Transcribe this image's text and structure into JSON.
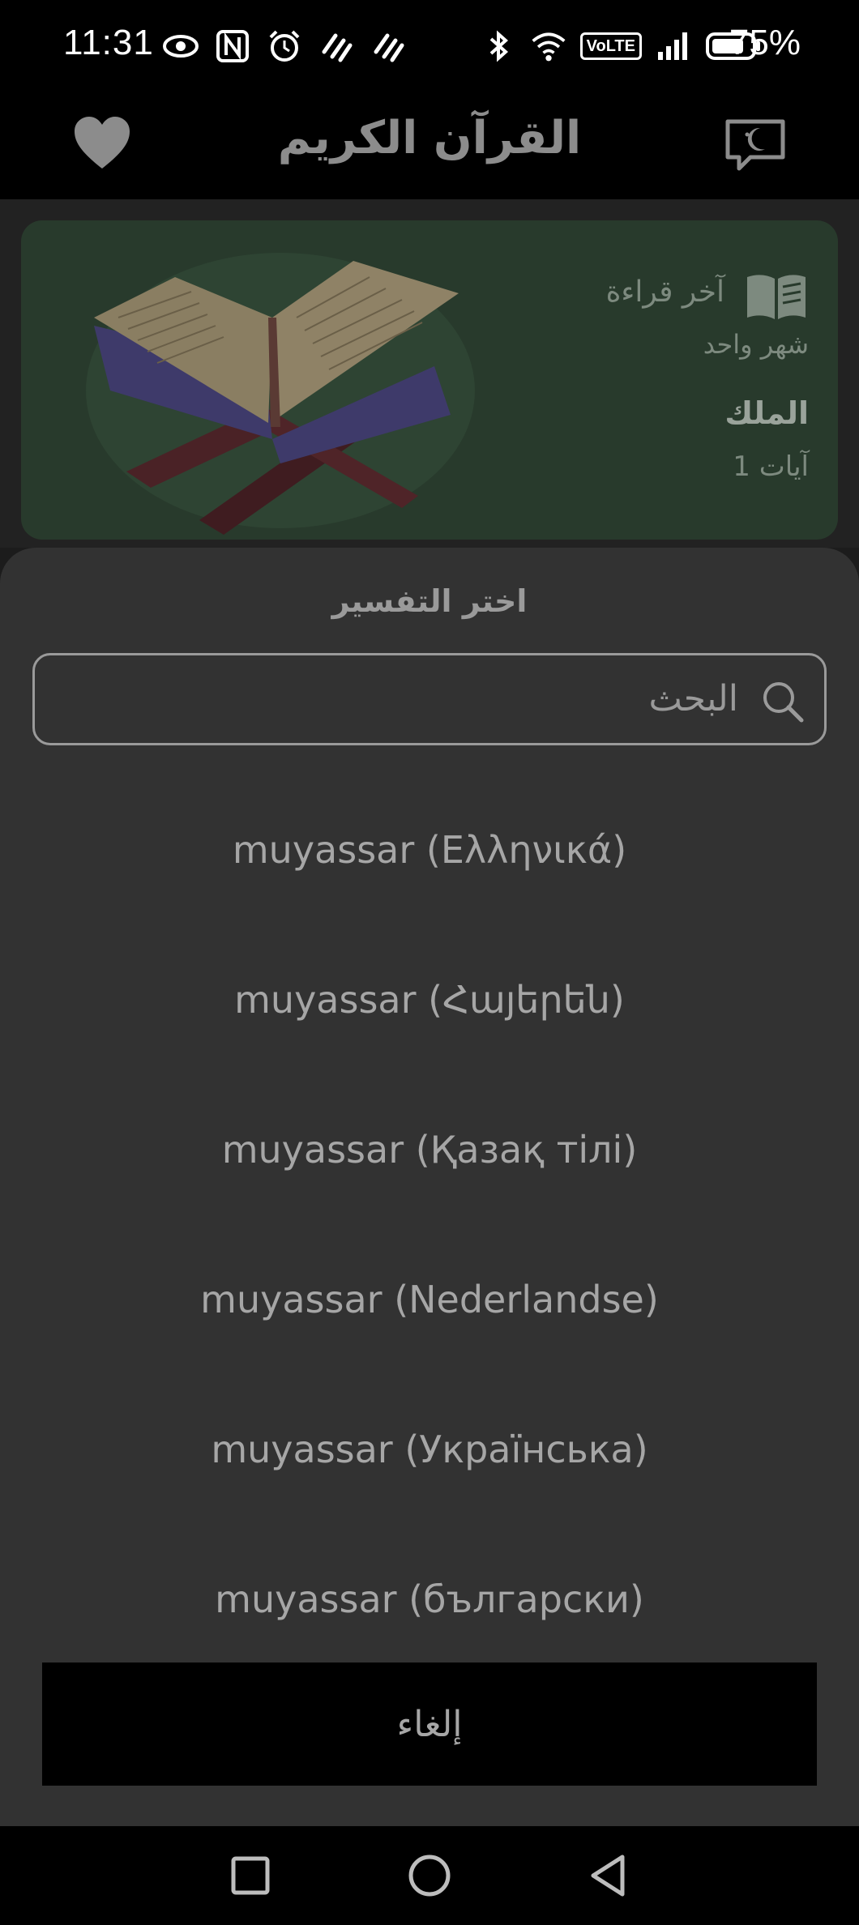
{
  "status_bar": {
    "time": "11:31",
    "volte": "VoLTE",
    "battery": "75%",
    "left_icons": [
      "eye-icon",
      "nfc-icon",
      "alarm-icon",
      "sync-icon",
      "sync-icon"
    ],
    "right_icons": [
      "bluetooth-icon",
      "wifi-icon",
      "volte-badge",
      "signal-icon",
      "battery-icon"
    ]
  },
  "app_bar": {
    "title": "القرآن الكريم",
    "left_icon": "heart-icon",
    "right_icon": "night-mode-icon"
  },
  "last_read": {
    "label": "آخر قراءة",
    "time_ago": "شهر واحد",
    "surah": "الملك",
    "ayah": "آيات 1",
    "icon": "open-book-icon"
  },
  "sheet": {
    "title": "اختر التفسير",
    "search_placeholder": "البحث",
    "items": [
      "muyassar (Ελληνικά)",
      "muyassar (Հայերեն)",
      "muyassar (Қазақ тілі)",
      "muyassar (Nederlandse)",
      "muyassar (Українська)",
      "muyassar (български)"
    ],
    "cancel_label": "إلغاء"
  },
  "nav_bar": {
    "icons": [
      "recents-square-icon",
      "home-circle-icon",
      "back-triangle-icon"
    ]
  },
  "colors": {
    "card_bg": "#283a2c",
    "sheet_bg": "#323232",
    "text_muted": "#a6a6a6"
  }
}
